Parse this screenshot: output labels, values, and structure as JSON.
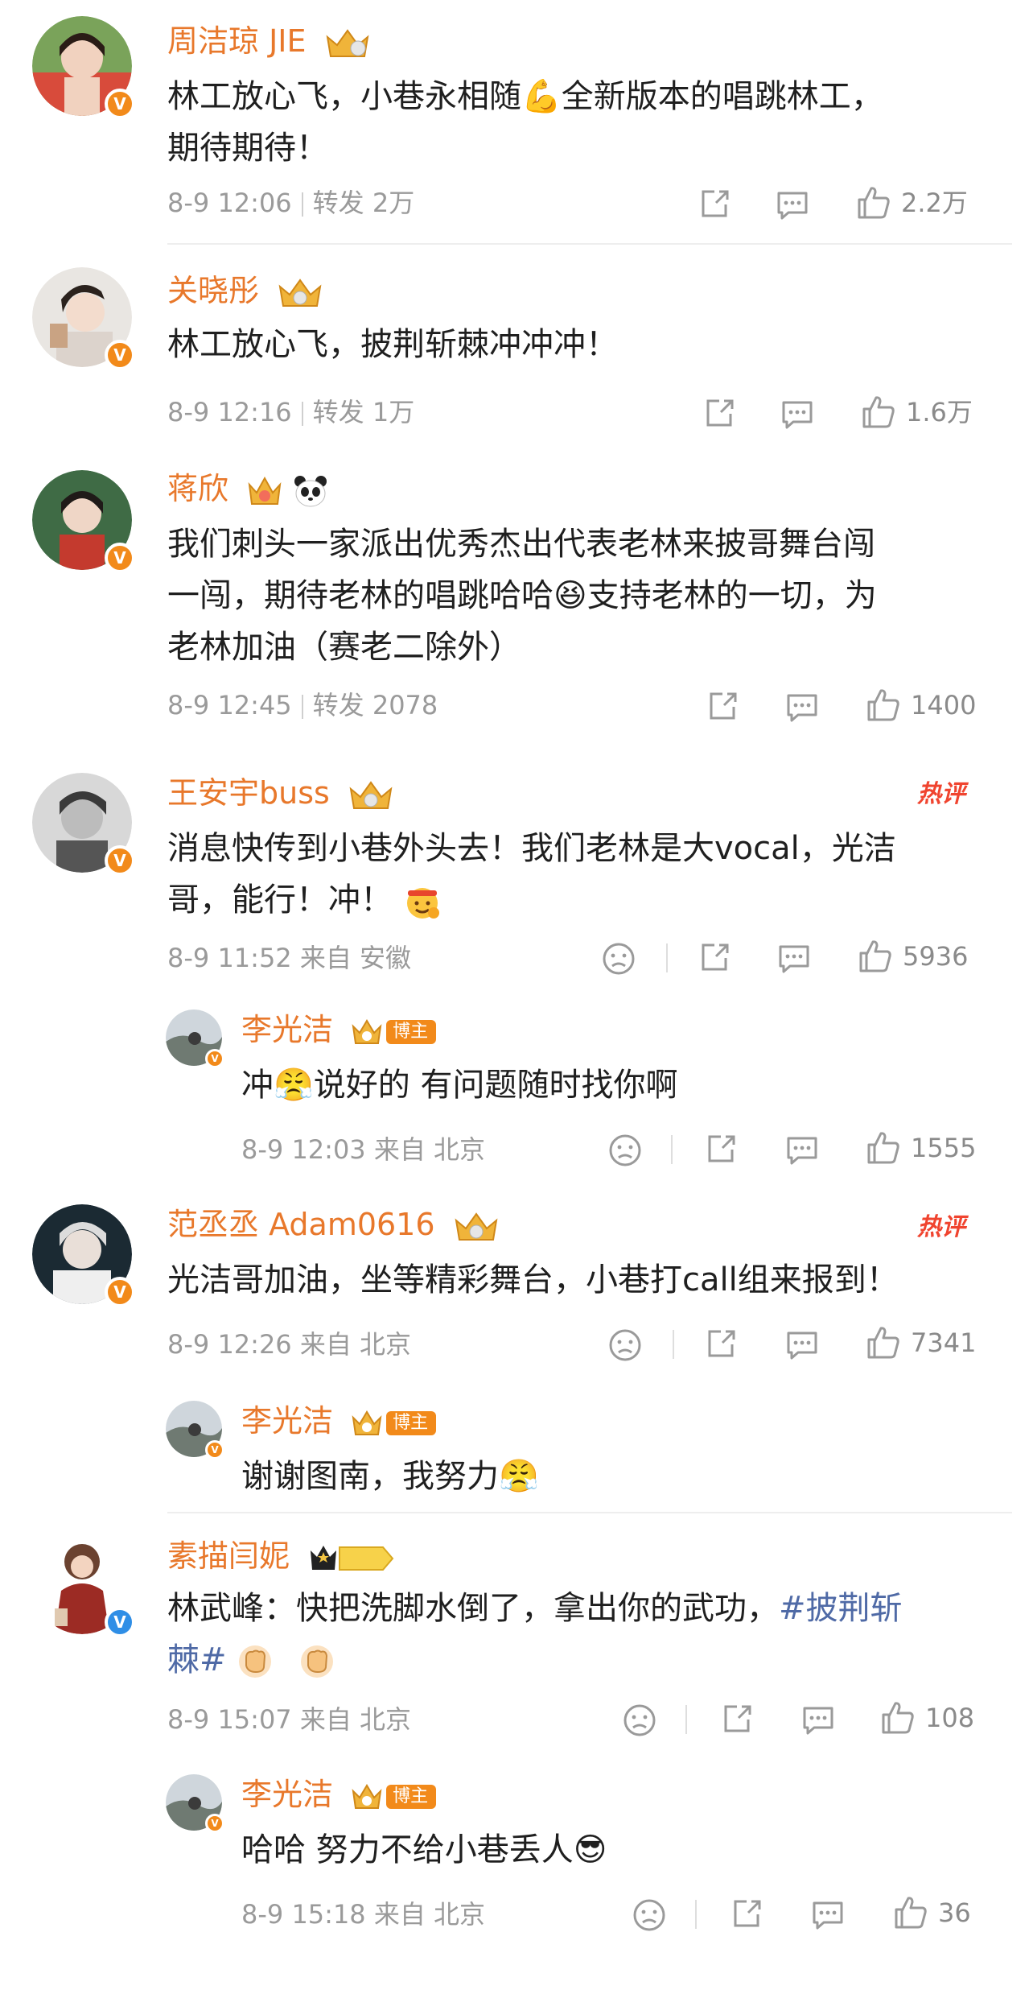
{
  "comments": [
    {
      "name": "周洁琼 JIE",
      "lines": [
        "林工放心飞，小巷永相随💪全新版本的唱跳林工，",
        "期待期待！"
      ],
      "meta": "8-9 12:06",
      "repost": "转发 2万",
      "likes": "2.2万"
    },
    {
      "name": "关晓彤",
      "lines": [
        "林工放心飞，披荆斩棘冲冲冲！"
      ],
      "meta": "8-9 12:16",
      "repost": "转发 1万",
      "likes": "1.6万"
    },
    {
      "name": "蒋欣",
      "lines": [
        "我们刺头一家派出优秀杰出代表老林来披哥舞台闯",
        "一闯，期待老林的唱跳哈哈😆支持老林的一切，为",
        "老林加油（赛老二除外）"
      ],
      "meta": "8-9 12:45",
      "repost": "转发 2078",
      "likes": "1400"
    },
    {
      "name": "王安宇buss",
      "hot": "热评",
      "lines": [
        "消息快传到小巷外头去！我们老林是大vocal，光洁",
        "哥，能行！冲！"
      ],
      "meta": "8-9 11:52 来自 安徽",
      "likes": "5936",
      "reply": {
        "name": "李光洁",
        "badge": "博主",
        "text": "冲😤说好的 有问题随时找你啊",
        "meta": "8-9 12:03 来自 北京",
        "likes": "1555"
      }
    },
    {
      "name": "范丞丞 Adam0616",
      "hot": "热评",
      "lines": [
        "光洁哥加油，坐等精彩舞台，小巷打call组来报到！"
      ],
      "meta": "8-9 12:26 来自 北京",
      "likes": "7341",
      "reply": {
        "name": "李光洁",
        "badge": "博主",
        "text": "谢谢图南，我努力😤",
        "meta": "",
        "likes": ""
      }
    },
    {
      "name": "素描闫妮",
      "level": "I",
      "line1": "林武峰：快把洗脚水倒了，拿出你的武功，",
      "hashtag1": "#披荆斩",
      "hashtag2": "棘#",
      "meta": "8-9 15:07 来自 北京",
      "likes": "108",
      "reply": {
        "name": "李光洁",
        "badge": "博主",
        "text": "哈哈 努力不给小巷丢人😎",
        "meta": "8-9 15:18 来自 北京",
        "likes": "36"
      }
    }
  ]
}
